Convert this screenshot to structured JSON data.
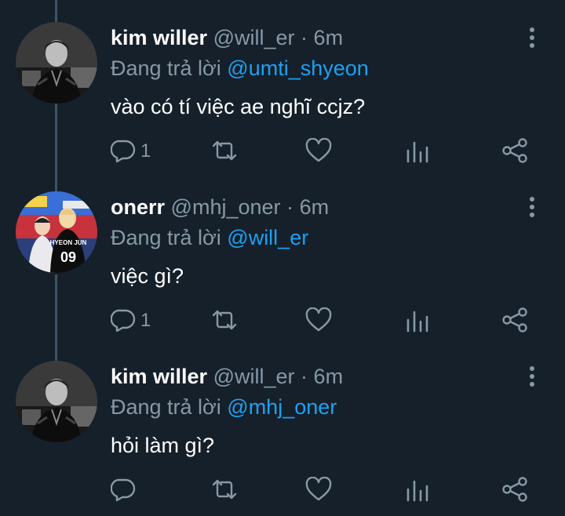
{
  "replying_prefix": "Đang trả lời",
  "colors": {
    "background": "#15202b",
    "text": "#ffffff",
    "muted": "#8899a6",
    "accent": "#1da1f2"
  },
  "tweets": [
    {
      "name": "kim willer",
      "handle": "@will_er",
      "separator": "·",
      "time": "6m",
      "reply_to": "@umti_shyeon",
      "text": "vào có tí việc ae nghĩ ccjz?",
      "reply_count": "1",
      "avatar": "person-in-black-jersey-photo"
    },
    {
      "name": "onerr",
      "handle": "@mhj_oner",
      "separator": "·",
      "time": "6m",
      "reply_to": "@will_er",
      "text": "việc gì?",
      "reply_count": "1",
      "avatar": "two-players-jersey-photo",
      "avatar_jersey_text": "HYEON JUN",
      "avatar_jersey_number": "09"
    },
    {
      "name": "kim willer",
      "handle": "@will_er",
      "separator": "·",
      "time": "6m",
      "reply_to": "@mhj_oner",
      "text": "hỏi làm gì?",
      "reply_count": "",
      "avatar": "person-in-black-jersey-photo"
    }
  ],
  "icons": [
    "reply-icon",
    "retweet-icon",
    "like-icon",
    "stats-icon",
    "share-icon",
    "more-options-icon"
  ]
}
